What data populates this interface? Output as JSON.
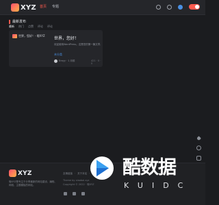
{
  "header": {
    "logo_text": "XYZ",
    "nav": [
      "首页",
      "专题"
    ],
    "colors": {
      "accent": "#ff5a4e",
      "link": "#4a90e2"
    }
  },
  "section": {
    "title": "最新发布",
    "tabs": [
      "最新",
      "热门",
      "点赞",
      "评论",
      "评论"
    ]
  },
  "post": {
    "thumb_label": "世界，您好！- 哦XYZ",
    "title": "世界，您好！",
    "excerpt": "欢迎使用WordPress。这是您的第一篇文章。编辑",
    "category": "未分类",
    "author": "Ereyy · 1 月前",
    "stats": "421 · 0 · 0"
  },
  "footer": {
    "logo_text": "XYZ",
    "description": "哦XYZ是专注于分享最新的网站建设、编程、网络、主题模板的网站。",
    "links": [
      "友情链接",
      "·",
      "关于本站",
      "·",
      "广告合作"
    ],
    "line2": "Theme by xiaobai.xyz",
    "line3": "Copyright © 2022 · 哦XYZ"
  },
  "watermark": {
    "main": "酷数据",
    "sub": "KUIDC"
  }
}
